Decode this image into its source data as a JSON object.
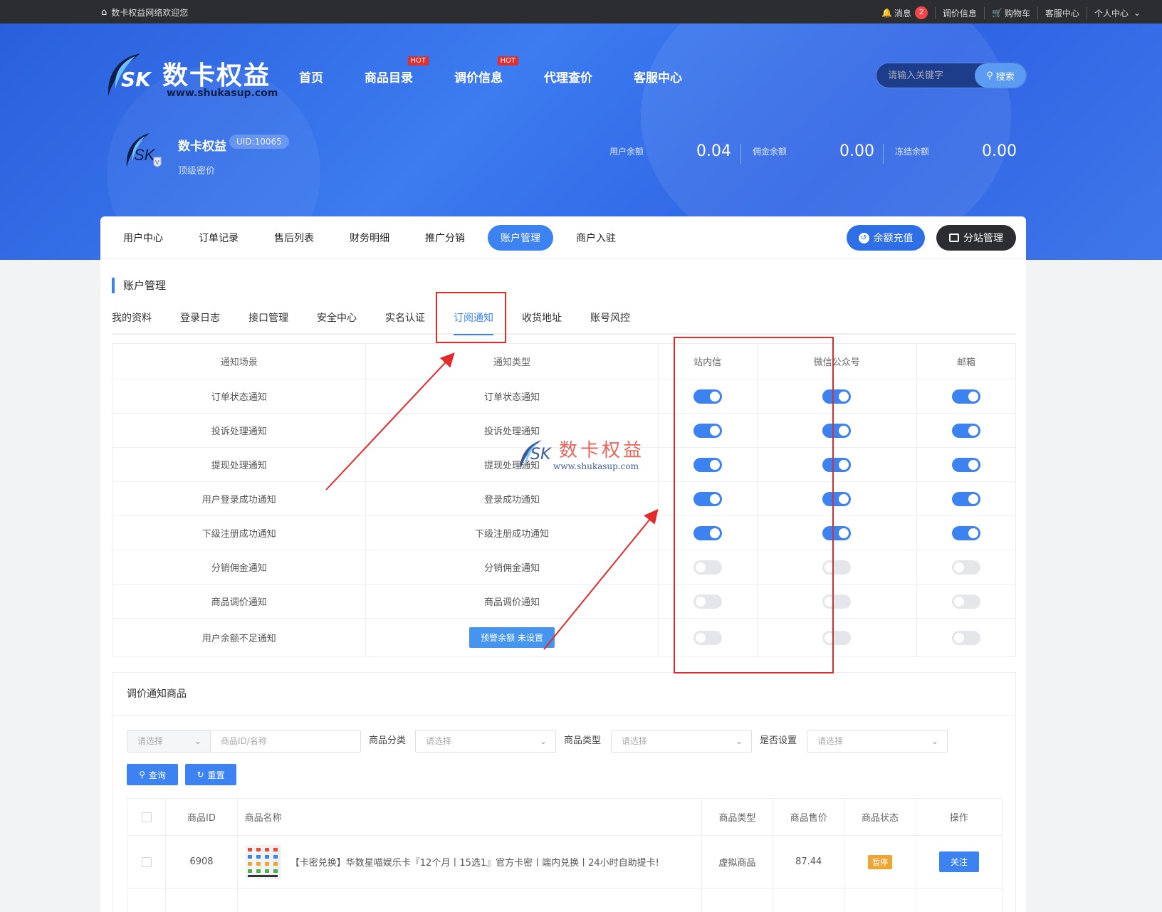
{
  "topbar": {
    "welcome": "数卡权益网络欢迎您",
    "messages": "消息",
    "message_count": "2",
    "price_info": "调价信息",
    "cart": "购物车",
    "service": "客服中心",
    "personal": "个人中心"
  },
  "header": {
    "logo_cn": "数卡权益",
    "logo_sk": "SK",
    "logo_url": "www.shukasup.com",
    "nav": [
      {
        "label": "首页",
        "hot": ""
      },
      {
        "label": "商品目录",
        "hot": "HOT"
      },
      {
        "label": "调价信息",
        "hot": "HOT"
      },
      {
        "label": "代理查价",
        "hot": ""
      },
      {
        "label": "客服中心",
        "hot": ""
      }
    ],
    "search_placeholder": "请输入关键字",
    "search_button": "搜索"
  },
  "profile": {
    "name": "数卡权益",
    "uid": "UID:10065",
    "level": "顶级密价",
    "balances": [
      {
        "label": "用户余额",
        "value": "0.04"
      },
      {
        "label": "佣金余额",
        "value": "0.00"
      },
      {
        "label": "冻结余额",
        "value": "0.00"
      }
    ]
  },
  "main_tabs": [
    "用户中心",
    "订单记录",
    "售后列表",
    "财务明细",
    "推广分销",
    "账户管理",
    "商户入驻"
  ],
  "main_tab_active": "账户管理",
  "recharge_button": "余额充值",
  "substation_button": "分站管理",
  "section_title": "账户管理",
  "sub_tabs": [
    "我的资料",
    "登录日志",
    "接口管理",
    "安全中心",
    "实名认证",
    "订阅通知",
    "收货地址",
    "账号风控"
  ],
  "sub_tab_active": "订阅通知",
  "notify_table": {
    "headers": [
      "通知场景",
      "通知类型",
      "站内信",
      "微信公众号",
      "邮箱"
    ],
    "rows": [
      {
        "scene": "订单状态通知",
        "type": "订单状态通知",
        "site": true,
        "wechat": true,
        "email": true
      },
      {
        "scene": "投诉处理通知",
        "type": "投诉处理通知",
        "site": true,
        "wechat": true,
        "email": true
      },
      {
        "scene": "提现处理通知",
        "type": "提现处理通知",
        "site": true,
        "wechat": true,
        "email": true
      },
      {
        "scene": "用户登录成功通知",
        "type": "登录成功通知",
        "site": true,
        "wechat": true,
        "email": true
      },
      {
        "scene": "下级注册成功通知",
        "type": "下级注册成功通知",
        "site": true,
        "wechat": true,
        "email": true
      },
      {
        "scene": "分销佣金通知",
        "type": "分销佣金通知",
        "site": false,
        "wechat": false,
        "email": false
      },
      {
        "scene": "商品调价通知",
        "type": "商品调价通知",
        "site": false,
        "wechat": false,
        "email": false
      },
      {
        "scene": "用户余额不足通知",
        "type": "",
        "type_button": "预警余额 未设置",
        "site": false,
        "wechat": false,
        "email": false
      }
    ]
  },
  "watermark": {
    "sk": "SK",
    "cn": "数卡权益",
    "url": "www.shukasup.com"
  },
  "price_notify": {
    "title": "调价通知商品",
    "filter_select_placeholder": "请选择",
    "id_placeholder": "商品ID/名称",
    "category_label": "商品分类",
    "category_placeholder": "请选择",
    "type_label": "商品类型",
    "type_placeholder": "请选择",
    "set_label": "是否设置",
    "set_placeholder": "请选择",
    "query_button": "查询",
    "reset_button": "重置",
    "table_headers": [
      "商品ID",
      "商品名称",
      "商品类型",
      "商品售价",
      "商品状态",
      "操作"
    ],
    "rows": [
      {
        "id": "6908",
        "name": "【卡密兑换】华数星喵娱乐卡『12个月丨15选1』官方卡密丨端内兑换丨24小时自助提卡!",
        "type": "虚拟商品",
        "price": "87.44",
        "status": "暂停",
        "action": "关注"
      }
    ]
  },
  "colors": {
    "accent": "#3c82f0",
    "topbar": "#2b2d30",
    "annotation": "#e22b2b",
    "paused": "#f0a531"
  }
}
